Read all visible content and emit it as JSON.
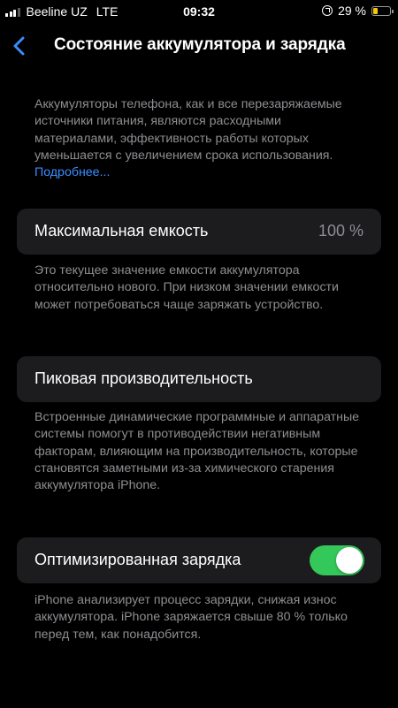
{
  "status_bar": {
    "carrier": "Beeline UZ",
    "network": "LTE",
    "time": "09:32",
    "battery_percent": "29 %",
    "battery_level": 0.29,
    "battery_color": "#f7c900",
    "icons": [
      "signal-icon",
      "orientation-lock-icon",
      "battery-icon"
    ]
  },
  "nav": {
    "back_icon": "chevron-left-icon",
    "title": "Состояние аккумулятора и зарядка"
  },
  "intro": {
    "text": "Аккумуляторы телефона, как и все перезаряжаемые источники питания, являются расходными материалами, эффективность работы которых уменьшается с увеличением срока использования.",
    "link": "Подробнее..."
  },
  "max_capacity": {
    "label": "Максимальная емкость",
    "value": "100 %",
    "footer": "Это текущее значение емкости аккумулятора относительно нового. При низком значении емкости может потребоваться чаще заряжать устройство."
  },
  "peak_performance": {
    "label": "Пиковая производительность",
    "footer": "Встроенные динамические программные и аппаратные системы помогут в противодействии негативным факторам, влияющим на производительность, которые становятся заметными из-за химического старения аккумулятора iPhone."
  },
  "optimized_charging": {
    "label": "Оптимизированная зарядка",
    "enabled": true,
    "toggle_color": "#34c759",
    "footer": "iPhone анализирует процесс зарядки, снижая износ аккумулятора. iPhone заряжается свыше 80 % только перед тем, как понадобится."
  }
}
